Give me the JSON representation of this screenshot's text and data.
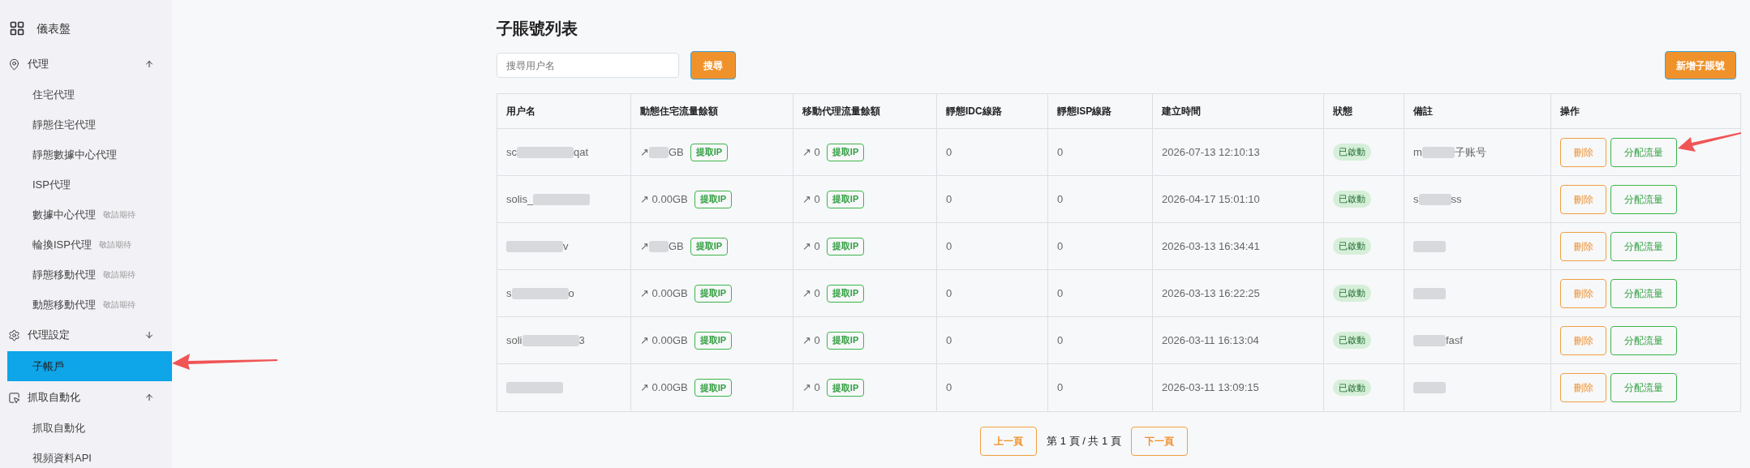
{
  "sidebar": [
    {
      "kind": "link",
      "label": "儀表盤"
    },
    {
      "kind": "section",
      "label": "代理",
      "expanded": true,
      "children": [
        {
          "label": "住宅代理",
          "selected": false
        },
        {
          "label": "靜態住宅代理",
          "selected": false
        },
        {
          "label": "靜態數據中心代理",
          "selected": false
        },
        {
          "label": "ISP代理",
          "selected": false
        },
        {
          "label": "數據中心代理",
          "badge": "敬請期待",
          "selected": false
        },
        {
          "label": "輪換ISP代理",
          "badge": "敬請期待",
          "selected": false
        },
        {
          "label": "靜態移動代理",
          "badge": "敬請期待",
          "selected": false
        },
        {
          "label": "動態移動代理",
          "badge": "敬請期待",
          "selected": false
        }
      ]
    },
    {
      "kind": "section",
      "label": "代理設定",
      "expanded": false,
      "children": [
        {
          "label": "子帳戶",
          "selected": true
        }
      ]
    },
    {
      "kind": "section",
      "label": "抓取自動化",
      "expanded": true,
      "children": [
        {
          "label": "抓取自動化",
          "selected": false
        },
        {
          "label": "視頻資料API",
          "selected": false
        }
      ]
    }
  ],
  "title": "子賬號列表",
  "search": {
    "placeholder": "搜尋用户名",
    "button": "搜尋"
  },
  "add_button": "新增子賬號",
  "table": {
    "columns": [
      "用户名",
      "動態住宅流量餘額",
      "移動代理流量餘額",
      "靜態IDC線路",
      "靜態ISP線路",
      "建立時間",
      "狀態",
      "備註",
      "操作"
    ],
    "rows": [
      {
        "user": {
          "before": "sc",
          "after": "qat"
        },
        "dynamic": {
          "before": "↗",
          "after": "GB"
        },
        "dynamic_button": "提取IP",
        "mobile": "↗ 0",
        "mobile_button": "提取IP",
        "idc": "0",
        "isp": "0",
        "created": "2026-07-13 12:10:13",
        "status": {
          "text": "已啟動",
          "active": true
        },
        "note": {
          "before": "m",
          "after": "子账号"
        },
        "actions": [
          "刪除",
          "分配流量"
        ]
      },
      {
        "user": {
          "before": "solis_"
        },
        "dynamic": "↗ 0.00GB",
        "dynamic_button": "提取IP",
        "mobile": "↗ 0",
        "mobile_button": "提取IP",
        "idc": "0",
        "isp": "0",
        "created": "2026-04-17 15:01:10",
        "status": {
          "text": "已啟動",
          "active": true
        },
        "note": {
          "before": "s",
          "after": "ss"
        },
        "actions": [
          "刪除",
          "分配流量"
        ]
      },
      {
        "user": {
          "after": "v"
        },
        "dynamic": {
          "before": "↗",
          "after": "GB"
        },
        "dynamic_button": "提取IP",
        "mobile": "↗ 0",
        "mobile_button": "提取IP",
        "idc": "0",
        "isp": "0",
        "created": "2026-03-13 16:34:41",
        "status": {
          "text": "已啟動",
          "active": true
        },
        "note": {
          "redacted": true
        },
        "actions": [
          "刪除",
          "分配流量"
        ]
      },
      {
        "user": {
          "before": "s",
          "after": "o"
        },
        "dynamic": "↗ 0.00GB",
        "dynamic_button": "提取IP",
        "mobile": "↗ 0",
        "mobile_button": "提取IP",
        "idc": "0",
        "isp": "0",
        "created": "2026-03-13 16:22:25",
        "status": {
          "text": "已啟動",
          "active": true
        },
        "note": {
          "redacted": true
        },
        "actions": [
          "刪除",
          "分配流量"
        ]
      },
      {
        "user": {
          "before": "soli",
          "after": "3"
        },
        "dynamic": "↗ 0.00GB",
        "dynamic_button": "提取IP",
        "mobile": "↗ 0",
        "mobile_button": "提取IP",
        "idc": "0",
        "isp": "0",
        "created": "2026-03-11 16:13:04",
        "status": {
          "text": "已啟動",
          "active": true
        },
        "note": {
          "after": "fasf"
        },
        "actions": [
          "刪除",
          "分配流量"
        ]
      },
      {
        "user": {
          "redacted": true
        },
        "dynamic": "↗ 0.00GB",
        "dynamic_button": "提取IP",
        "mobile": "↗ 0",
        "mobile_button": "提取IP",
        "idc": "0",
        "isp": "0",
        "created": "2026-03-11 13:09:15",
        "status": {
          "text": "已啟動",
          "active": true
        },
        "note": {
          "redacted": true
        },
        "actions": [
          "刪除",
          "分配流量"
        ]
      }
    ]
  },
  "pagination": {
    "prev": "上一頁",
    "info": "第 1 頁 / 共 1 頁",
    "next": "下一頁"
  }
}
